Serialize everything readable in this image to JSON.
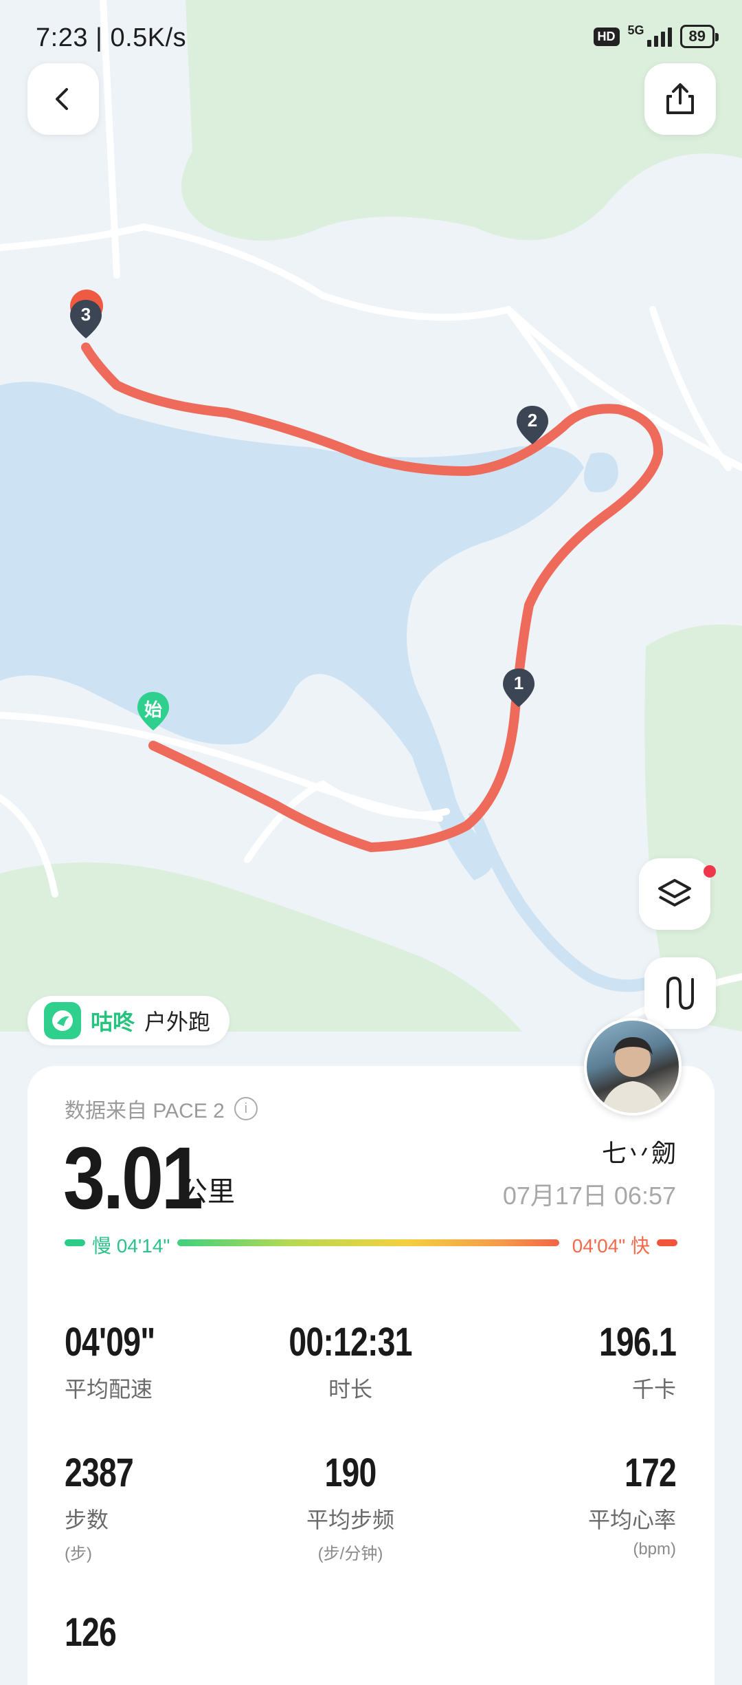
{
  "status_bar": {
    "time": "7:23 | 0.5K/s",
    "hd": "HD",
    "network": "5G",
    "battery": "89"
  },
  "map": {
    "start_marker": "始",
    "split_markers": [
      "1",
      "2",
      "3"
    ],
    "route_color": "#ee6b5c",
    "water_color": "#cde3f3",
    "green_color": "#dcefdc"
  },
  "toolbar": {
    "back_icon": "chevron-left-icon",
    "share_icon": "share-icon",
    "layers_icon": "layers-icon",
    "route_icon": "route-icon"
  },
  "sport_tag": {
    "brand": "咕咚",
    "kind": "户外跑"
  },
  "summary": {
    "source": "数据来自 PACE 2",
    "distance": "3.01",
    "distance_unit": "公里",
    "user_name": "七丷劒",
    "date": "07月17日 06:57",
    "pace_slow_label": "慢 04'14\"",
    "pace_fast_label": "04'04\" 快"
  },
  "stats": [
    {
      "value": "04'09\"",
      "label": "平均配速",
      "sub": ""
    },
    {
      "value": "00:12:31",
      "label": "时长",
      "sub": ""
    },
    {
      "value": "196.1",
      "label": "千卡",
      "sub": ""
    },
    {
      "value": "2387",
      "label": "步数",
      "sub": "(步)"
    },
    {
      "value": "190",
      "label": "平均步频",
      "sub": "(步/分钟)"
    },
    {
      "value": "172",
      "label": "平均心率",
      "sub": "(bpm)"
    },
    {
      "value": "126",
      "label": "",
      "sub": ""
    }
  ]
}
